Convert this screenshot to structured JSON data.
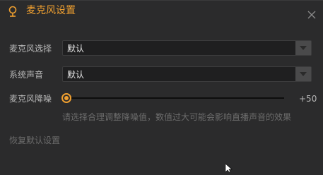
{
  "window": {
    "title": "麦克风设置",
    "accent_color": "#f0a030",
    "title_icon": "microphone-icon",
    "close_icon": "close-icon"
  },
  "microphone": {
    "label": "麦克风选择",
    "selected": "默认"
  },
  "system_sound": {
    "label": "系统声音",
    "selected": "默认"
  },
  "noise_reduction": {
    "label": "麦克风降噪",
    "value_text": "+50",
    "slider_position": 0,
    "hint": "请选择合理调整降噪值，数值过大可能会影响直播声音的效果"
  },
  "reset": {
    "label": "恢复默认设置"
  }
}
